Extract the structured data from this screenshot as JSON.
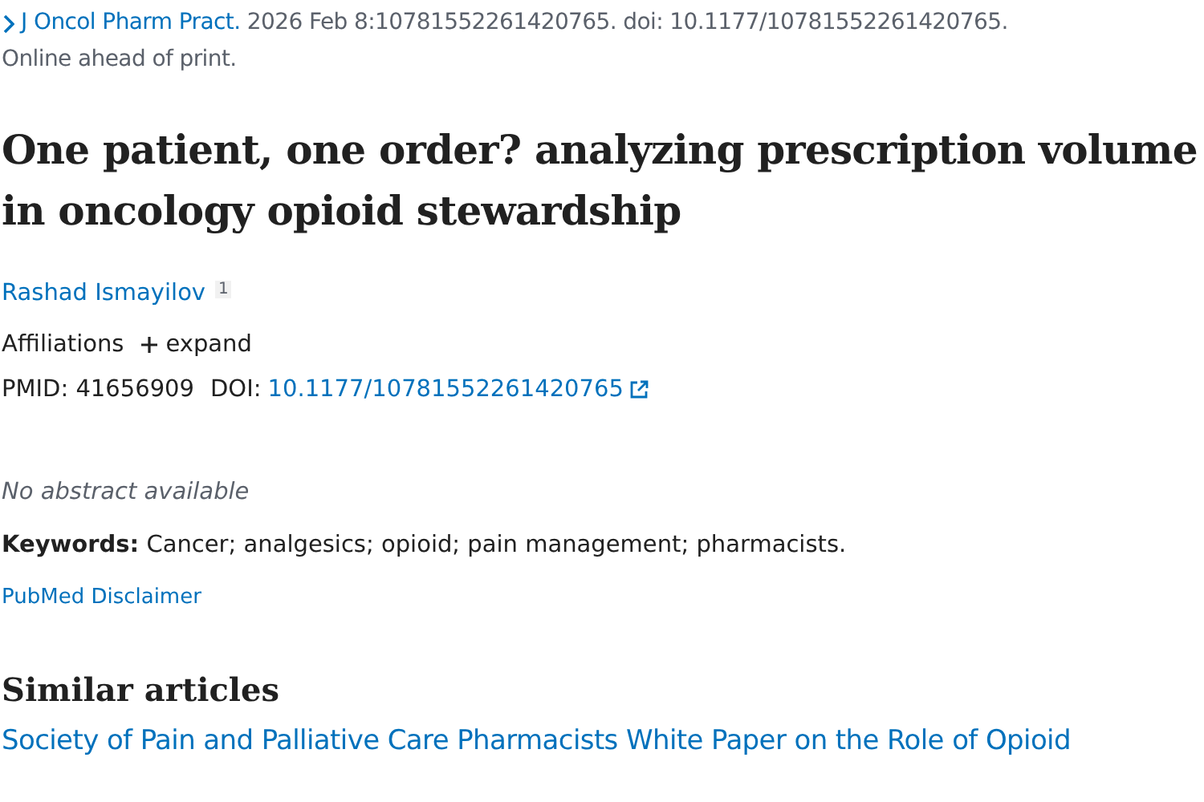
{
  "citation": {
    "journal": "J Oncol Pharm Pract.",
    "details": "2026 Feb 8:10781552261420765. doi: 10.1177/10781552261420765.",
    "status": "Online ahead of print."
  },
  "title": "One patient, one order? analyzing prescription volume in oncology opioid stewardship",
  "authors": [
    {
      "name": "Rashad Ismayilov",
      "affiliation_ref": "1"
    }
  ],
  "affiliations": {
    "label": "Affiliations",
    "toggle": "expand",
    "expanded": false
  },
  "identifiers": {
    "pmid_label": "PMID:",
    "pmid": "41656909",
    "doi_label": "DOI:",
    "doi": "10.1177/10781552261420765"
  },
  "abstract_note": "No abstract available",
  "keywords": {
    "label": "Keywords:",
    "text": "Cancer; analgesics; opioid; pain management; pharmacists."
  },
  "disclaimer_link": "PubMed Disclaimer",
  "similar_articles": {
    "heading": "Similar articles",
    "items": [
      {
        "title": "Society of Pain and Palliative Care Pharmacists White Paper on the Role of Opioid"
      }
    ]
  }
}
